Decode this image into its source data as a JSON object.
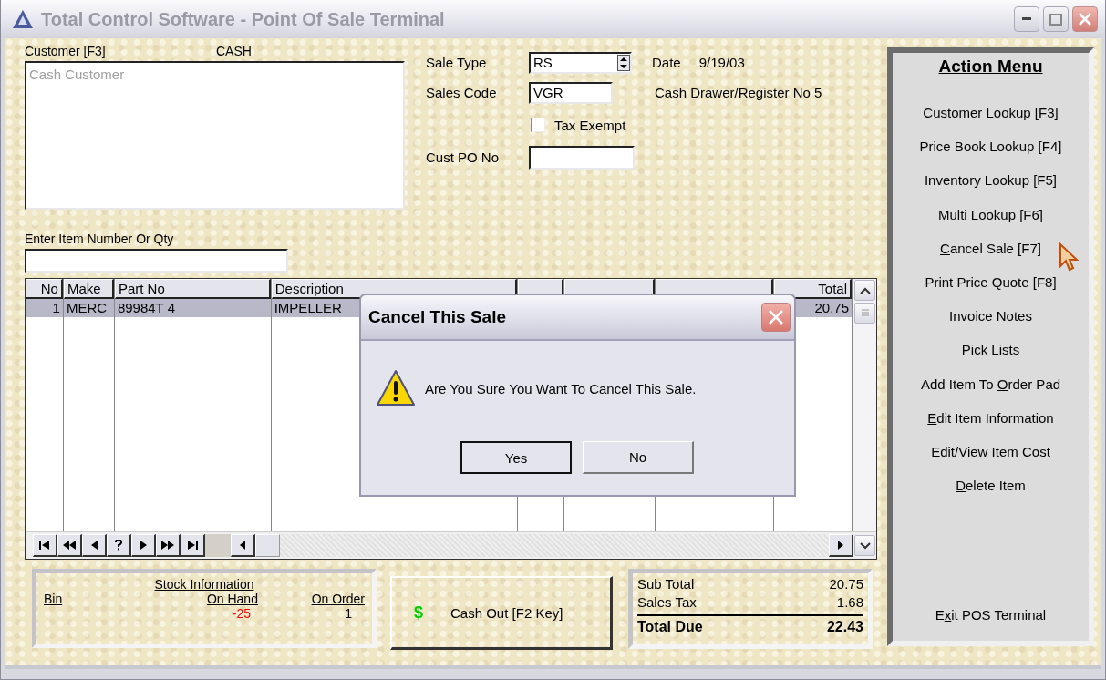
{
  "window": {
    "title": "Total Control Software - Point Of Sale Terminal"
  },
  "customer": {
    "label": "Customer [F3]",
    "code": "CASH",
    "memo_placeholder": "Cash Customer"
  },
  "sale": {
    "sale_type_label": "Sale Type",
    "sale_type": "RS",
    "date_label": "Date",
    "date": "9/19/03",
    "sales_code_label": "Sales Code",
    "sales_code": "VGR",
    "register": "Cash Drawer/Register No 5",
    "tax_exempt": {
      "label": "Tax Exempt",
      "checked": false
    },
    "cust_po_label": "Cust PO No"
  },
  "item_entry": {
    "label": "Enter Item Number Or Qty"
  },
  "table": {
    "columns": [
      "No",
      "Make",
      "Part No",
      "Description",
      null,
      null,
      null,
      "Total"
    ],
    "rows": [
      {
        "selected": true,
        "cells": [
          "1",
          "MERC",
          "89984T 4",
          "IMPELLER",
          null,
          null,
          null,
          "20.75"
        ]
      }
    ]
  },
  "stock": {
    "title": "Stock Information",
    "bin_label": "Bin",
    "on_hand_label": "On Hand",
    "on_hand": "-25",
    "on_hand_negative": true,
    "on_order_label": "On Order",
    "on_order": "1"
  },
  "cash_out": {
    "icon": "$",
    "label": "Cash Out [F2 Key]"
  },
  "totals": [
    {
      "kind": "line",
      "label": "Sub Total",
      "value": "20.75"
    },
    {
      "kind": "line",
      "label": "Sales Tax",
      "value": "1.68"
    },
    {
      "kind": "total",
      "label": "Total Due",
      "value": "22.43"
    }
  ],
  "action_menu": {
    "title": "Action Menu",
    "items": [
      {
        "label": "Customer Lookup [F3]"
      },
      {
        "label": "Price Book Lookup [F4]"
      },
      {
        "label": "Inventory Lookup [F5]"
      },
      {
        "label": "Multi Lookup [F6]"
      },
      {
        "accesskey": "C",
        "label": "ancel Sale [F7]"
      },
      {
        "label": "Print Price Quote [F8]"
      },
      {
        "label": "Invoice Notes"
      },
      {
        "label": "Pick Lists"
      },
      {
        "prefix": "Add Item To ",
        "accesskey": "O",
        "label": "rder Pad"
      },
      {
        "accesskey": "E",
        "label": "dit Item Information"
      },
      {
        "prefix": "Edit/",
        "accesskey": "V",
        "label": "iew Item Cost"
      },
      {
        "accesskey": "D",
        "label": "elete Item"
      }
    ],
    "exit": {
      "prefix": "E",
      "accesskey": "x",
      "label": "it POS Terminal"
    }
  },
  "dialog": {
    "title": "Cancel This Sale",
    "message": "Are You Sure You Want To Cancel This Sale.",
    "buttons": [
      "Yes",
      "No"
    ]
  }
}
